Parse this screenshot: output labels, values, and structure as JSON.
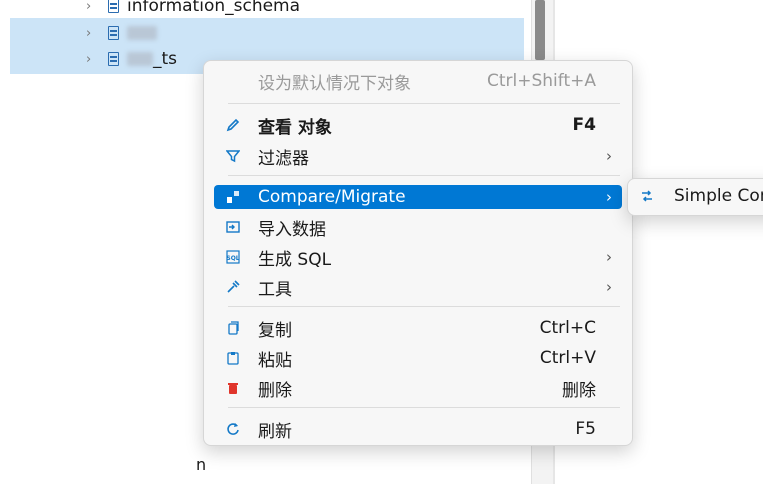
{
  "tree": {
    "rows": [
      {
        "label": "information_schema",
        "selected": false
      },
      {
        "label": "",
        "selected": true
      },
      {
        "label": "_ts",
        "selected": true
      }
    ],
    "partial_text_1": "",
    "partial_text_2": "n"
  },
  "context_menu": {
    "set_default": {
      "label": "设为默认情况下对象",
      "shortcut": "Ctrl+Shift+A"
    },
    "view_object": {
      "label": "查看  对象",
      "shortcut": "F4"
    },
    "filter": {
      "label": "过滤器",
      "arrow": "›"
    },
    "compare_migrate": {
      "label": "Compare/Migrate",
      "arrow": "›"
    },
    "import_data": {
      "label": "导入数据"
    },
    "generate_sql": {
      "label": "生成 SQL",
      "arrow": "›"
    },
    "tools": {
      "label": "工具",
      "arrow": "›"
    },
    "copy": {
      "label": "复制",
      "shortcut": "Ctrl+C"
    },
    "paste": {
      "label": "粘贴",
      "shortcut": "Ctrl+V"
    },
    "delete": {
      "label": "删除",
      "shortcut": "删除"
    },
    "refresh": {
      "label": "刷新",
      "shortcut": "F5"
    }
  },
  "submenu": {
    "simple_compare": {
      "label": "Simple Cor"
    }
  },
  "colors": {
    "highlight": "#0078d4",
    "selection": "#cce4f7",
    "icon_blue": "#1479c7",
    "delete_red": "#e0352b"
  }
}
